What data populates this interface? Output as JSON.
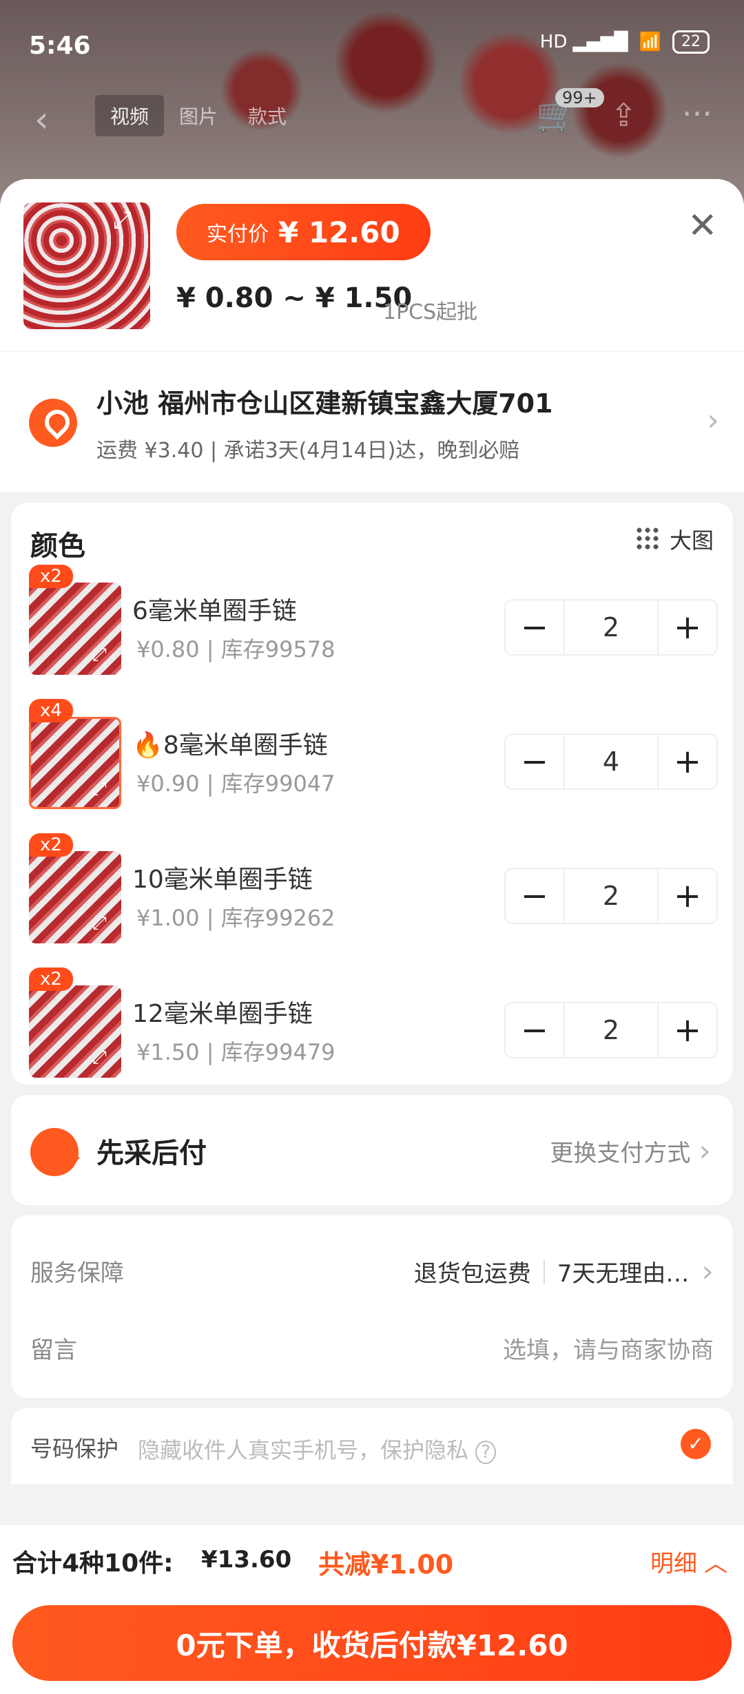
{
  "status": {
    "time": "5:46",
    "network": "HD",
    "battery": "22"
  },
  "nav": {
    "tabs": [
      "视频",
      "图片",
      "款式"
    ],
    "cart_badge": "99+"
  },
  "header": {
    "pay_label": "实付价",
    "pay_amount": "¥ 12.60",
    "price_range": "¥ 0.80 ~ ¥ 1.50",
    "moq": "1PCS起批"
  },
  "address": {
    "line": "小池 福州市仓山区建新镇宝鑫大厦701",
    "shipping": "运费 ¥3.40 | 承诺3天(4月14日)达，晚到必赔"
  },
  "colors": {
    "title": "颜色",
    "big_image": "大图",
    "items": [
      {
        "badge": "x2",
        "name": "6毫米单圈手链",
        "sub": "¥0.80 | 库存99578",
        "qty": "2"
      },
      {
        "badge": "x4",
        "name": "🔥8毫米单圈手链",
        "sub": "¥0.90 | 库存99047",
        "qty": "4"
      },
      {
        "badge": "x2",
        "name": "10毫米单圈手链",
        "sub": "¥1.00 | 库存99262",
        "qty": "2"
      },
      {
        "badge": "x2",
        "name": "12毫米单圈手链",
        "sub": "¥1.50 | 库存99479",
        "qty": "2"
      }
    ]
  },
  "payment": {
    "title": "先采后付",
    "action": "更换支付方式"
  },
  "service": {
    "label": "服务保障",
    "value1": "退货包运费",
    "value2": "7天无理由…",
    "msg_label": "留言",
    "msg_placeholder": "选填，请与商家协商"
  },
  "phone": {
    "label": "号码保护",
    "hint": "隐藏收件人真实手机号，保护隐私"
  },
  "footer": {
    "total": "合计4种10件:",
    "total_amount": "¥13.60",
    "reduce": "共减¥1.00",
    "detail": "明细",
    "order_button": "0元下单，收货后付款¥12.60"
  },
  "colors_theme": {
    "accent": "#ff5a1f"
  }
}
